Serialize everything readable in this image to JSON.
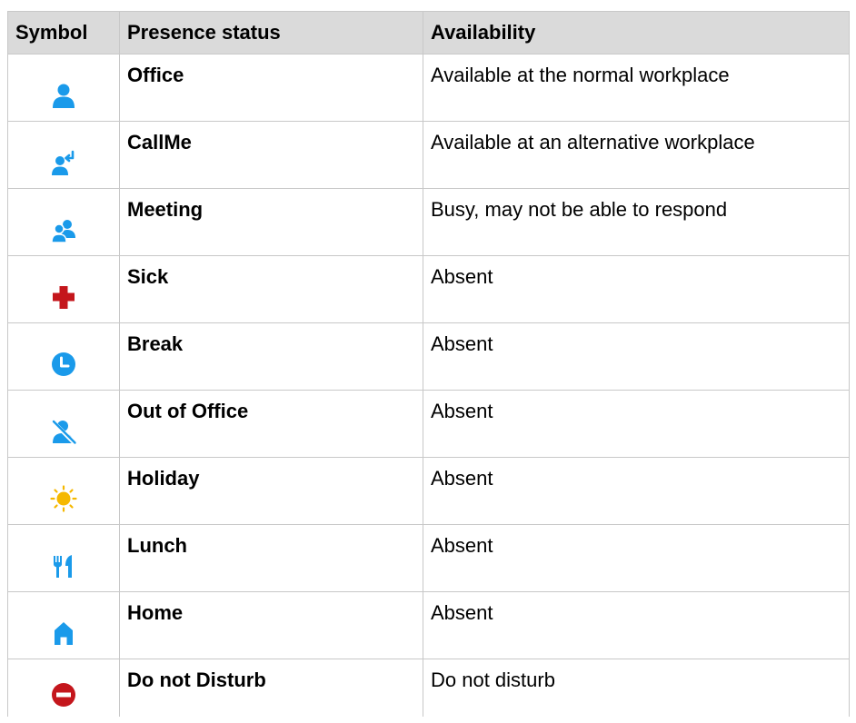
{
  "table": {
    "headers": [
      "Symbol",
      "Presence status",
      "Availability"
    ],
    "rows": [
      {
        "icon": "person-icon",
        "color": "#1a9aea",
        "status": "Office",
        "availability": "Available at the normal workplace"
      },
      {
        "icon": "callme-icon",
        "color": "#1a9aea",
        "status": "CallMe",
        "availability": "Available at an alternative workplace"
      },
      {
        "icon": "meeting-icon",
        "color": "#1a9aea",
        "status": "Meeting",
        "availability": "Busy, may not be able to respond"
      },
      {
        "icon": "red-cross-icon",
        "color": "#c4161c",
        "status": "Sick",
        "availability": "Absent"
      },
      {
        "icon": "clock-icon",
        "color": "#1a9aea",
        "status": "Break",
        "availability": "Absent"
      },
      {
        "icon": "person-crossed-icon",
        "color": "#1a9aea",
        "status": "Out of Office",
        "availability": "Absent"
      },
      {
        "icon": "sun-icon",
        "color": "#f5b800",
        "status": "Holiday",
        "availability": "Absent"
      },
      {
        "icon": "cutlery-icon",
        "color": "#1a9aea",
        "status": "Lunch",
        "availability": "Absent"
      },
      {
        "icon": "house-icon",
        "color": "#1a9aea",
        "status": "Home",
        "availability": "Absent"
      },
      {
        "icon": "no-entry-icon",
        "color": "#c4161c",
        "status": "Do not Disturb",
        "availability": "Do not disturb"
      }
    ]
  }
}
